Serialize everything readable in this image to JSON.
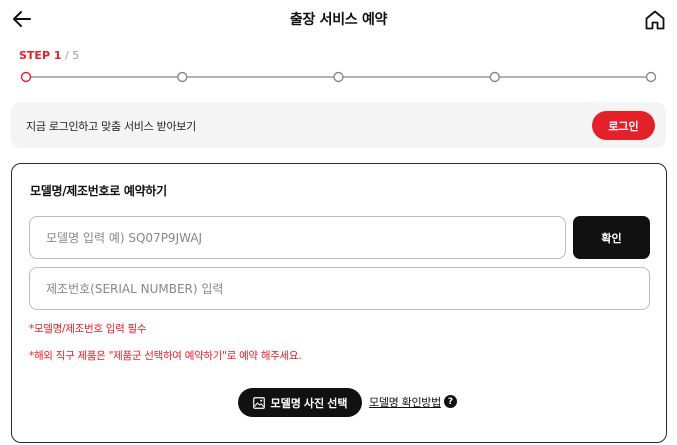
{
  "header": {
    "title": "출장 서비스 예약",
    "back_icon": "arrow-left-icon",
    "home_icon": "home-icon"
  },
  "stepper": {
    "label": "STEP 1",
    "separator": " / ",
    "total": "5",
    "current_step": 1,
    "step_count": 5,
    "active_color": "#e4212b",
    "inactive_color": "#888888"
  },
  "login_banner": {
    "text": "지금 로그인하고 맞춤 서비스 받아보기",
    "button_label": "로그인"
  },
  "model_form": {
    "title": "모델명/제조번호로 예약하기",
    "model_placeholder": "모델명 입력 예) SQ07P9JWAJ",
    "confirm_label": "확인",
    "serial_placeholder": "제조번호(SERIAL NUMBER) 입력",
    "note_required": "*모델명/제조번호 입력 필수",
    "note_overseas": "*해외 직구 제품은 \"제품군 선택하여 예약하기\"로 예약 해주세요.",
    "photo_button_label": "모델명 사진 선택",
    "photo_icon": "image-icon",
    "how_to_label": "모델명 확인방법",
    "help_icon": "question-icon",
    "help_glyph": "?"
  },
  "colors": {
    "accent": "#e4212b",
    "dark": "#111111",
    "banner_bg": "#f4f4f4"
  }
}
